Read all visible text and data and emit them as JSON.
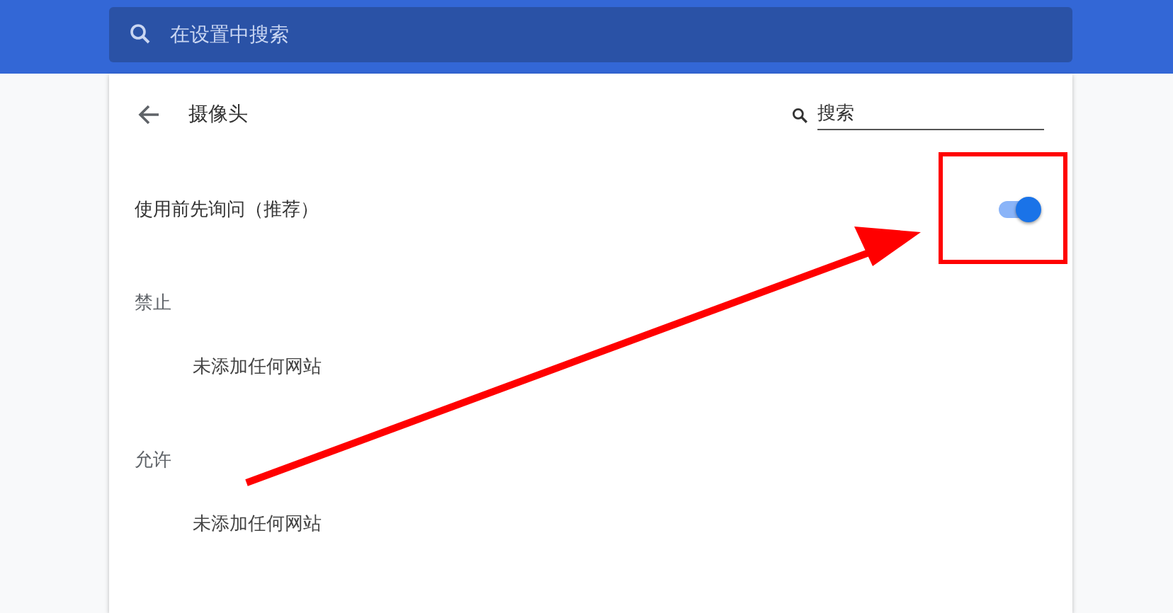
{
  "top_search": {
    "placeholder": "在设置中搜索"
  },
  "page": {
    "title": "摄像头",
    "search": {
      "value": "搜索"
    }
  },
  "setting": {
    "label": "使用前先询问（推荐）",
    "on": true
  },
  "sections": [
    {
      "heading": "禁止",
      "empty_text": "未添加任何网站"
    },
    {
      "heading": "允许",
      "empty_text": "未添加任何网站"
    }
  ],
  "annotations": {
    "highlight_box": true,
    "arrow": true
  }
}
